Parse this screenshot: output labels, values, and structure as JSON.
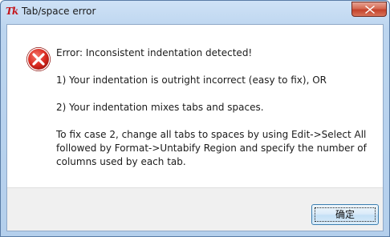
{
  "window": {
    "title": "Tab/space error",
    "app_icon_text": "Tk"
  },
  "dialog": {
    "icon": "error-icon",
    "message_lines": {
      "line1": "Error: Inconsistent indentation detected!",
      "line2": "1) Your indentation is outright incorrect (easy to fix), OR",
      "line3": "2) Your indentation mixes tabs and spaces.",
      "line4a": "To fix case 2, change all tabs to spaces by using Edit->Select All",
      "line4b": "followed by Format->Untabify Region and specify the number of",
      "line4c": "columns used by each tab."
    },
    "ok_label": "确定"
  },
  "colors": {
    "error_red": "#d22b2b",
    "close_button": "#c94a35",
    "button_border": "#3c7fb1"
  }
}
